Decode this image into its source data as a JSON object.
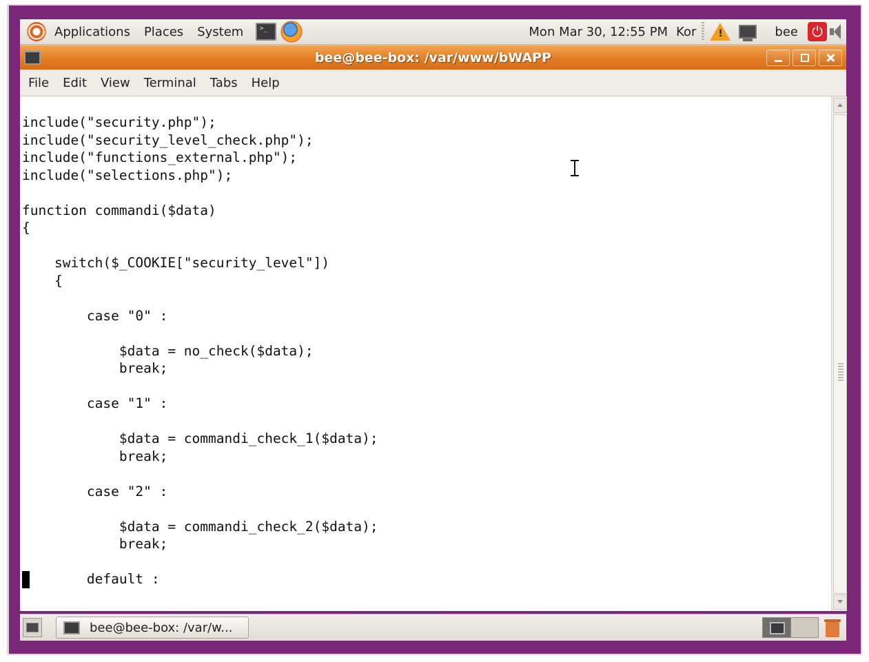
{
  "top_panel": {
    "menus": [
      "Applications",
      "Places",
      "System"
    ],
    "clock": "Mon Mar 30, 12:55 PM",
    "keyboard_layout": "Kor",
    "user": "bee",
    "icons": [
      "ubuntu-logo-icon",
      "terminal-launcher-icon",
      "firefox-launcher-icon",
      "warning-icon",
      "network-icon",
      "power-icon",
      "volume-icon"
    ]
  },
  "window": {
    "title": "bee@bee-box: /var/www/bWAPP",
    "menus": [
      "File",
      "Edit",
      "View",
      "Terminal",
      "Tabs",
      "Help"
    ],
    "colors": {
      "titlebar": "#e27c22",
      "desktop": "#7a2679"
    }
  },
  "terminal": {
    "lines": [
      "include(\"security.php\");",
      "include(\"security_level_check.php\");",
      "include(\"functions_external.php\");",
      "include(\"selections.php\");",
      "",
      "function commandi($data)",
      "{",
      "",
      "    switch($_COOKIE[\"security_level\"])",
      "    {",
      "",
      "        case \"0\" :",
      "",
      "            $data = no_check($data);",
      "            break;",
      "",
      "        case \"1\" :",
      "",
      "            $data = commandi_check_1($data);",
      "            break;",
      "",
      "        case \"2\" :",
      "",
      "            $data = commandi_check_2($data);",
      "            break;",
      "",
      "        default :"
    ]
  },
  "bottom_panel": {
    "task_label": "bee@bee-box: /var/w..."
  }
}
